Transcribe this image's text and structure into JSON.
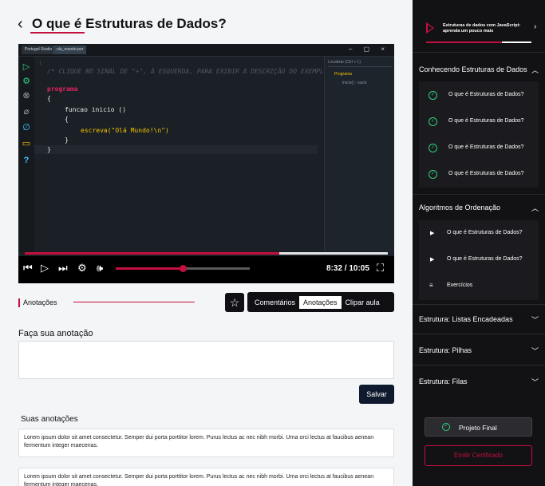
{
  "page": {
    "title": "O que é Estruturas de Dados?"
  },
  "video": {
    "app_tabs": [
      "Portugol Studio",
      "ola_mundo.por"
    ],
    "code_comment": "/* CLIQUE NO SINAL DE \"+\", À ESQUERDA, PARA EXIBIR A DESCRIÇÃO DO EXEMPLO",
    "code_lines": [
      "programa",
      "{",
      "funcao inicio ()",
      "{",
      "escreva(\"Olá Mundo!\\n\")",
      "}",
      "}"
    ],
    "right_panel": {
      "search_placeholder": "Localizar (Ctrl + L)",
      "tree_root": "Programa",
      "tree_child": "inicio() : vazio"
    },
    "progress": 0.7,
    "volume": 0.5,
    "time_current": "8:32",
    "time_total": "10:05",
    "timecode": "8:32 / 10:05"
  },
  "notes": {
    "section_label": "Anotações",
    "tabs": [
      "Comentários",
      "Anotações",
      "Clipar aula"
    ],
    "active_tab": "Anotações",
    "field_label": "Faça sua anotação",
    "input_value": "",
    "save_label": "Salvar",
    "your_notes_label": "Suas anotações",
    "items": [
      "Lorem ipsum dolor sit amet consectetur. Semper dui porta porttitor lorem. Purus lectus ac nec nibh morbi. Urna orci lectus at faucibus aenean fermentum integer maecenas.",
      "Lorem ipsum dolor sit amet consectetur. Semper dui porta porttitor lorem. Purus lectus ac nec nibh morbi. Urna orci lectus at faucibus aenean fermentum integer maecenas."
    ]
  },
  "sidebar": {
    "course_title": "Estruturas de dados com JavaScript: aprenda um pouco mais",
    "course_progress": 0.72,
    "sections": [
      {
        "title": "Conhecendo Estruturas de Dados",
        "expanded": true,
        "lessons": [
          {
            "label": "O que é Estruturas de Dados?",
            "icon": "check-circle-icon"
          },
          {
            "label": "O que é Estruturas de Dados?",
            "icon": "check-circle-icon"
          },
          {
            "label": "O que é Estruturas de Dados?",
            "icon": "check-circle-icon"
          },
          {
            "label": "O que é Estruturas de Dados?",
            "icon": "check-circle-icon"
          }
        ]
      },
      {
        "title": "Algoritmos de Ordenação",
        "expanded": true,
        "lessons": [
          {
            "label": "O que é Estruturas de Dados?",
            "icon": "play-icon"
          },
          {
            "label": "O que é Estruturas de Dados?",
            "icon": "play-icon"
          },
          {
            "label": "Exercícios",
            "icon": "list-icon"
          }
        ]
      },
      {
        "title": "Estrutura: Listas Encadeadas",
        "expanded": false
      },
      {
        "title": "Estrutura: Pilhas",
        "expanded": false
      },
      {
        "title": "Estrutura: Filas",
        "expanded": false
      }
    ],
    "final_project_label": "Projeto Final",
    "certificate_label": "Emitir Certificado"
  },
  "colors": {
    "accent": "#c4103f",
    "success": "#2fd07a",
    "sidebar_bg": "#121214",
    "dark_button": "#0f1a2e"
  }
}
